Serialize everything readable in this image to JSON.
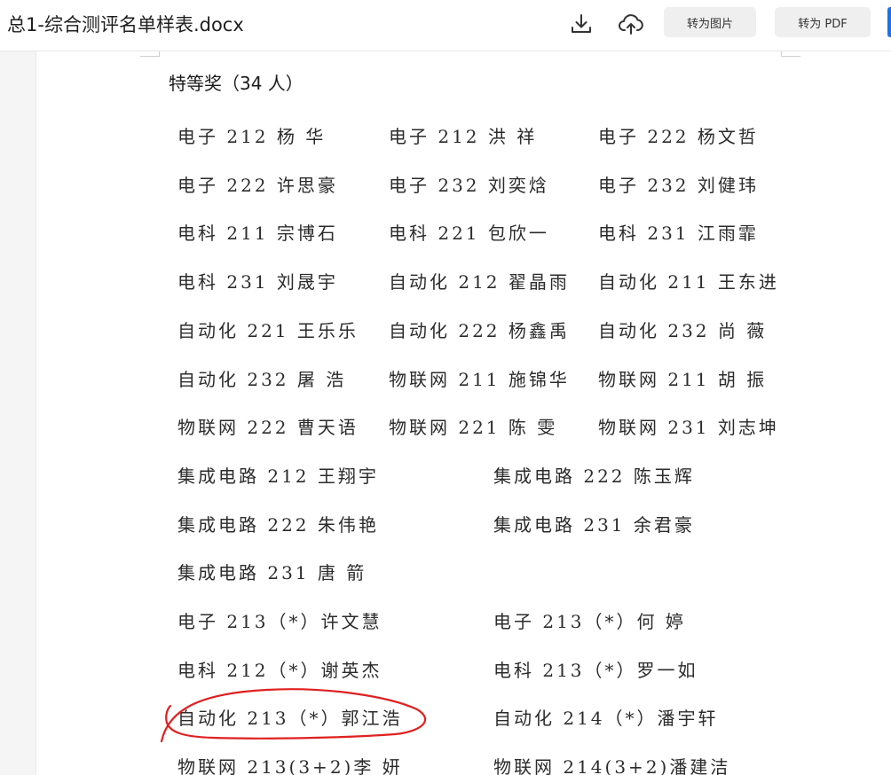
{
  "app": {
    "doc_title": "总1-综合测评名单样表.docx",
    "toolbar": {
      "download_icon": "download-icon",
      "cloud_icon": "cloud-upload-icon",
      "to_image_label": "转为图片",
      "to_pdf_label": "转为 PDF"
    }
  },
  "document": {
    "heading": "特等奖（34 人）",
    "three_column_rows": [
      [
        "电子 212  杨  华",
        "电子 212  洪  祥",
        "电子 222  杨文哲"
      ],
      [
        "电子 222  许思豪",
        "电子 232  刘奕焓",
        "电子 232  刘健玮"
      ],
      [
        "电科 211  宗博石",
        "电科 221  包欣一",
        "电科 231  江雨霏"
      ],
      [
        "电科 231  刘晟宇",
        "自动化 212  翟晶雨",
        "自动化 211  王东进"
      ],
      [
        "自动化 221  王乐乐",
        "自动化 222  杨鑫禹",
        "自动化 232  尚  薇"
      ],
      [
        "自动化 232  屠  浩",
        "物联网 211  施锦华",
        "物联网 211  胡  振"
      ],
      [
        "物联网 222  曹天语",
        "物联网 221  陈  雯",
        "物联网 231  刘志坤"
      ]
    ],
    "two_column_rows": [
      [
        "集成电路 212  王翔宇",
        "集成电路 222  陈玉辉"
      ],
      [
        "集成电路 222  朱伟艳",
        "集成电路 231  余君豪"
      ],
      [
        "集成电路 231  唐  箭",
        ""
      ],
      [
        "电子 213（*）许文慧",
        "电子 213（*）何  婷"
      ],
      [
        "电科 212（*）谢英杰",
        "电科 213（*）罗一如"
      ],
      [
        "自动化 213（*）郭江浩",
        "自动化 214（*）潘宇轩"
      ],
      [
        "物联网 213(3+2)李  妍",
        "物联网 214(3+2)潘建洁"
      ]
    ]
  },
  "annotation": {
    "color": "#e02020"
  },
  "colors": {
    "accent": "#1a73e8",
    "page": "#ffffff",
    "background": "#f5f5f5"
  }
}
